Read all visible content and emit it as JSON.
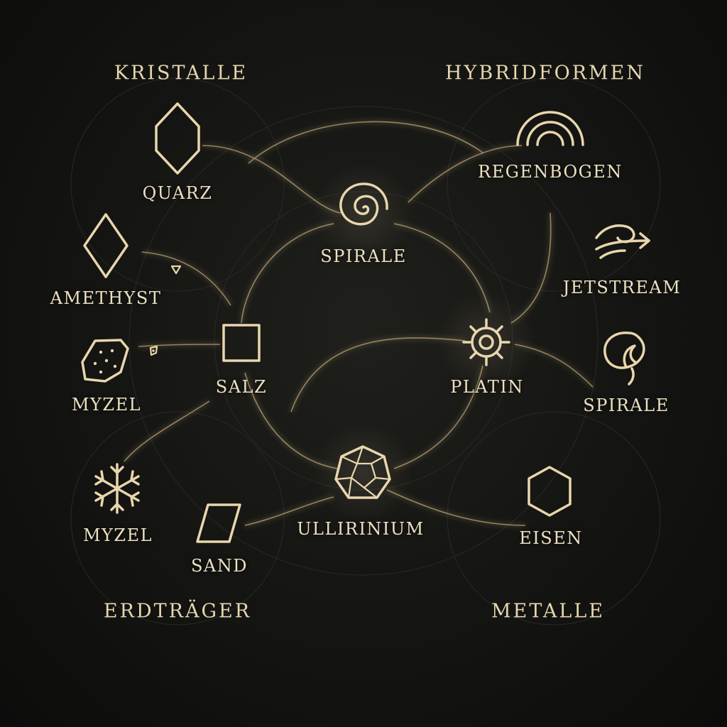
{
  "diagram": {
    "accent_color": "#e8d6ad",
    "line_color": "#c9b584",
    "background_color": "#141412",
    "categories": {
      "crystals": "KRISTALLE",
      "hybrids": "HYBRIDFORMEN",
      "earth_carriers": "ERDTRÄGER",
      "metals": "METALLE"
    },
    "nodes": {
      "quarz": {
        "label": "QUARZ",
        "icon": "elongated-hexagon-crystal-icon"
      },
      "amethyst": {
        "label": "AMETHYST",
        "icon": "diamond-icon"
      },
      "myzel_1": {
        "label": "MYZEL",
        "icon": "speckled-polygon-icon"
      },
      "myzel_2": {
        "label": "MYZEL",
        "icon": "snowflake-icon"
      },
      "sand": {
        "label": "SAND",
        "icon": "parallelogram-icon"
      },
      "salz": {
        "label": "SALZ",
        "icon": "square-icon"
      },
      "spirale_center": {
        "label": "SPIRALE",
        "icon": "spiral-icon"
      },
      "regenbogen": {
        "label": "REGENBOGEN",
        "icon": "rainbow-arcs-icon"
      },
      "jetstream": {
        "label": "JETSTREAM",
        "icon": "swirl-arrow-icon"
      },
      "platin": {
        "label": "PLATIN",
        "icon": "gear-icon"
      },
      "spirale_right": {
        "label": "SPIRALE",
        "icon": "leaf-spiral-icon"
      },
      "ullirinium": {
        "label": "ULLIRINIUM",
        "icon": "dodecahedron-icon"
      },
      "eisen": {
        "label": "EISEN",
        "icon": "hexagon-icon"
      }
    },
    "decorations": [
      "small-triangle-icon",
      "small-pebble-icon"
    ]
  }
}
